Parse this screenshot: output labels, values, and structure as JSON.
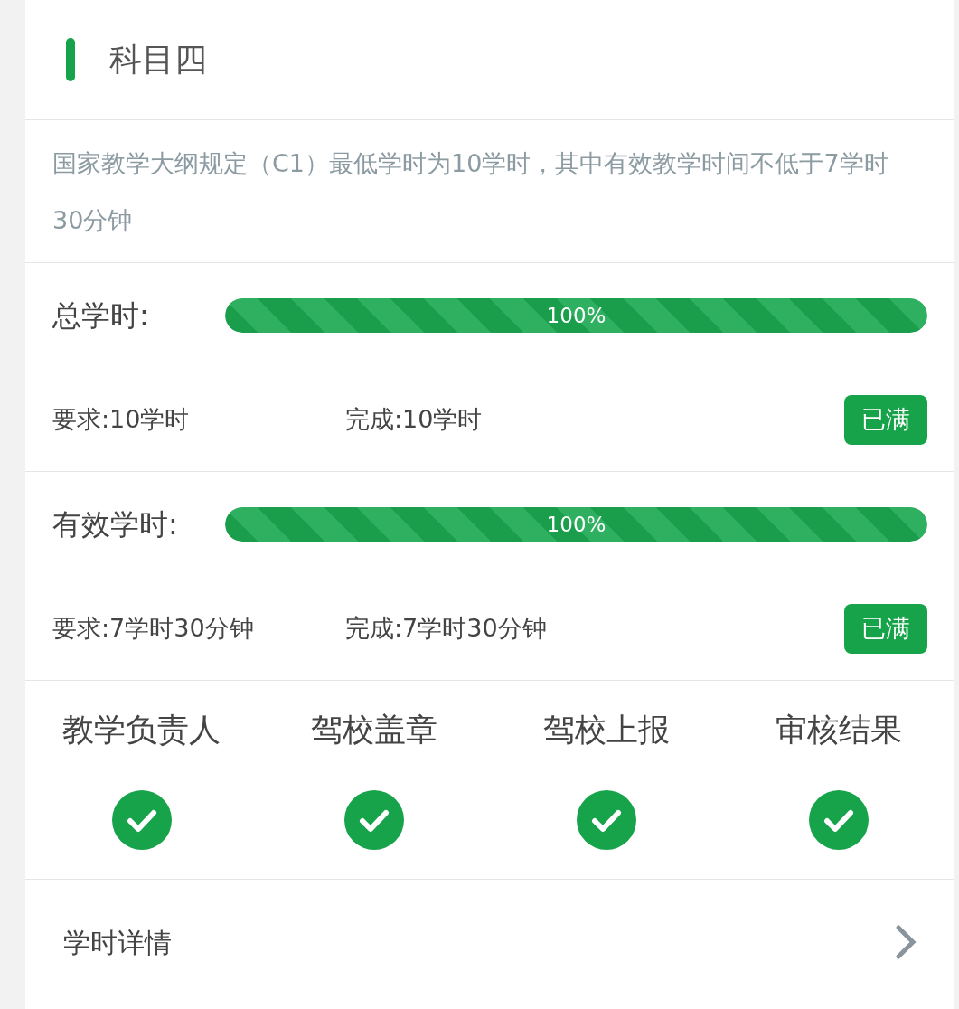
{
  "title": "科目四",
  "description": "国家教学大纲规定（C1）最低学时为10学时，其中有效教学时间不低于7学时30分钟",
  "sections": [
    {
      "label": "总学时:",
      "level": 1,
      "reading": "100%",
      "required": "要求:10学时",
      "completed": "完成:10学时",
      "badge": "已满"
    },
    {
      "label": "有效学时:",
      "level": 1,
      "reading": "100%",
      "required": "要求:7学时30分钟",
      "completed": "完成:7学时30分钟",
      "badge": "已满"
    }
  ],
  "steps": [
    {
      "label": "教学负责人",
      "checked": true
    },
    {
      "label": "驾校盖章",
      "checked": true
    },
    {
      "label": "驾校上报",
      "checked": true
    },
    {
      "label": "审核结果",
      "checked": true
    }
  ],
  "details_link": "学时详情"
}
